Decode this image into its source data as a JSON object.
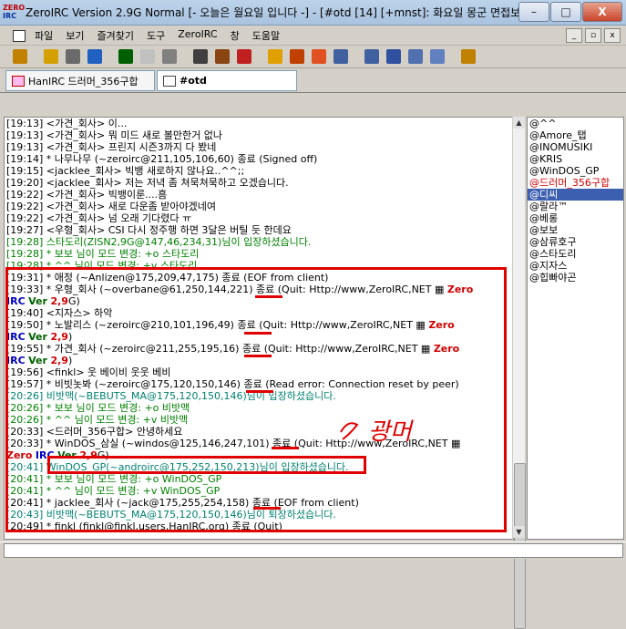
{
  "window": {
    "title": "ZeroIRC Version 2.9G Normal [- 오늘은 월요일 입니다 -] - [#otd [14] [+mnst]: 화요일 몽군 면접보러",
    "logo_line1": "ZERO",
    "logo_line2": "IRC",
    "minimize": "–",
    "maximize": "□",
    "close": "X"
  },
  "menu": {
    "items": [
      "파일",
      "보기",
      "즐겨찾기",
      "도구",
      "ZeroIRC",
      "창",
      "도움말"
    ],
    "mdi": [
      "_",
      "▫",
      "x"
    ]
  },
  "toolbar": {
    "buttons": [
      {
        "name": "connect-icon",
        "color": "#c08000"
      },
      {
        "name": "disconnect-icon",
        "color": "#d4a000"
      },
      {
        "name": "options-icon",
        "color": "#6a6a6a"
      },
      {
        "name": "favorites-icon",
        "color": "#2060c0"
      },
      {
        "name": "channel-list-icon",
        "color": "#006000"
      },
      {
        "name": "stop-icon",
        "color": "#c0c0c0"
      },
      {
        "name": "notify-icon",
        "color": "#808080"
      },
      {
        "name": "timer-icon",
        "color": "#404040"
      },
      {
        "name": "address-book-icon",
        "color": "#8b4513"
      },
      {
        "name": "color-icon",
        "color": "#c02020"
      },
      {
        "name": "script-icon",
        "color": "#e0a000"
      },
      {
        "name": "dcc-icon",
        "color": "#c04000"
      },
      {
        "name": "dcc-chat-icon",
        "color": "#e05020"
      },
      {
        "name": "cascade-icon",
        "color": "#4060a0"
      },
      {
        "name": "tile-icon",
        "color": "#4060a0"
      },
      {
        "name": "url-icon",
        "color": "#3050a0"
      },
      {
        "name": "log-icon",
        "color": "#5070b0"
      },
      {
        "name": "layout-icon",
        "color": "#6080c0"
      },
      {
        "name": "help-icon",
        "color": "#c08000"
      }
    ]
  },
  "tabs": [
    {
      "label": "HanIRC 드러머_356구합"
    },
    {
      "label": "#otd"
    }
  ],
  "chat": [
    {
      "time": "[19:13]",
      "text": " <가견_회사> 이...",
      "style": ""
    },
    {
      "time": "[19:13]",
      "text": " <가견_회사> 뭐 미드 새로 볼만한거 없나",
      "style": ""
    },
    {
      "time": "[19:13]",
      "text": " <가견_회사> 프린지 시즌3까지 다 봤네",
      "style": ""
    },
    {
      "time": "[19:14]",
      "text": " * 나무나무 (~zeroirc@211,105,106,60) 종료 (Signed off)",
      "style": ""
    },
    {
      "time": "[19:15]",
      "text": " <jacklee_회사> 빅뱅 새로하지 않나요..^^;;",
      "style": ""
    },
    {
      "time": "[19:20]",
      "text": " <jacklee_회사> 저는 저녁 좀 쳐묵쳐묵하고 오겠습니다.",
      "style": ""
    },
    {
      "time": "[19:22]",
      "text": " <가견_회사> 빅뱅이룬....흠",
      "style": ""
    },
    {
      "time": "[19:22]",
      "text": " <가견_회사> 새로 다운좀 받아야겠네여",
      "style": ""
    },
    {
      "time": "[19:22]",
      "text": " <가견_회사> 넘 오래 기다렸다 ㅠ",
      "style": ""
    },
    {
      "time": "[19:27]",
      "text": " <우형_회사> CSI 다시 정주행 하면 3달은 버틸 듯 한데요",
      "style": ""
    },
    {
      "time": "[19:28]",
      "text": " 스타도리(ZISN2,9G@147,46,234,31)님이 입장하셨습니다.",
      "style": "green"
    },
    {
      "time": "[19:28]",
      "text": " * 보보 님이 모드 변경: +o 스타도리",
      "style": "green"
    },
    {
      "time": "[19:28]",
      "text": " * ^^ 님이 모드 변경: +v 스타도리",
      "style": "green"
    },
    {
      "time": "[19:31]",
      "text": " * 애정 (~Anlizen@175,209,47,175) 종료 (EOF from client)",
      "style": ""
    },
    {
      "time": "[19:33]",
      "text": " * 우형_회사 (~overbane@61,250,144,221) 종료 (Quit: Http://www,ZeroIRC,NET ▦ ",
      "style": "",
      "tag": "Zero"
    },
    {
      "time": "",
      "text": "",
      "style": "",
      "tag_cont": [
        "IRC",
        "Ver",
        "2,9",
        "G)"
      ]
    },
    {
      "time": "[19:40]",
      "text": " <지자스> 하악",
      "style": ""
    },
    {
      "time": "[19:50]",
      "text": " * 노발리스 (~zeroirc@210,101,196,49) 종료 (Quit: Http://www,ZeroIRC,NET ▦ ",
      "style": "",
      "tag": "Zero"
    },
    {
      "time": "",
      "text": "",
      "style": "",
      "tag_cont": [
        "IRC",
        "Ver",
        "2,9",
        ")"
      ]
    },
    {
      "time": "[19:55]",
      "text": " * 가견_회사 (~zeroirc@211,255,195,16) 종료 (Quit: Http://www,ZeroIRC,NET ▦ ",
      "style": "",
      "tag": "Zero"
    },
    {
      "time": "",
      "text": "",
      "style": "",
      "tag_cont": [
        "IRC",
        "Ver",
        "2,9",
        ")"
      ]
    },
    {
      "time": "[19:56]",
      "text": " <finkl> 웃 베이비 웃웃 베비",
      "style": ""
    },
    {
      "time": "[19:57]",
      "text": " * 비빗놋봐 (~zeroirc@175,120,150,146) 종료 (Read error: Connection reset by peer)",
      "style": ""
    },
    {
      "time": "[20:26]",
      "text": " 비밧맥(~BEBUTS_MA@175,120,150,146)님이 입장하셨습니다.",
      "style": "join"
    },
    {
      "time": "[20:26]",
      "text": " * 보보 님이 모드 변경: +o 비밧맥",
      "style": "green"
    },
    {
      "time": "[20:26]",
      "text": " * ^^ 님이 모드 변경: +v 비밧맥",
      "style": "green"
    },
    {
      "time": "[20:33]",
      "text": " <드러머_356구합> 안녕하세요",
      "style": "",
      "nickred": true
    },
    {
      "time": "[20:33]",
      "text": " * WinDOS_삼실 (~windos@125,146,247,101) 종료 (Quit: Http://www,ZeroIRC,NET ▦",
      "style": ""
    },
    {
      "time": "",
      "text": "",
      "style": "",
      "tag_cont2": [
        "Zero",
        "IRC",
        "Ver",
        "2,9",
        "G)"
      ]
    },
    {
      "time": "[20:41]",
      "text": " WinDOS_GP(~androirc@175,252,150,213)님이 입장하셨습니다.",
      "style": "join"
    },
    {
      "time": "[20:41]",
      "text": " * 보보 님이 모드 변경: +o WinDOS_GP",
      "style": "green"
    },
    {
      "time": "[20:41]",
      "text": " * ^^ 님이 모드 변경: +v WinDOS_GP",
      "style": "green"
    },
    {
      "time": "[20:41]",
      "text": " * jacklee_회사 (~jack@175,255,254,158) 종료 (EOF from client)",
      "style": ""
    },
    {
      "time": "[20:43]",
      "text": " 비밧맥(~BEBUTS_MA@175,120,150,146)님이 퇴장하셨습니다.",
      "style": "join"
    },
    {
      "time": "[20:49]",
      "text": " * finkl (finkl@finkl,users,HanIRC,org) 종료 (Quit)",
      "style": ""
    }
  ],
  "nicklist": [
    {
      "nick": "@^^",
      "style": ""
    },
    {
      "nick": "@Amore_탭",
      "style": ""
    },
    {
      "nick": "@INOMUSIKI",
      "style": ""
    },
    {
      "nick": "@KRIS",
      "style": ""
    },
    {
      "nick": "@WinDOS_GP",
      "style": ""
    },
    {
      "nick": "@드러머_356구합",
      "style": "red"
    },
    {
      "nick": "@디씨",
      "style": "sel"
    },
    {
      "nick": "@랄라™",
      "style": ""
    },
    {
      "nick": "@베롱",
      "style": ""
    },
    {
      "nick": "@보보",
      "style": ""
    },
    {
      "nick": "@삼류호구",
      "style": ""
    },
    {
      "nick": "@스타도리",
      "style": ""
    },
    {
      "nick": "@지자스",
      "style": ""
    },
    {
      "nick": "@힙빠야곤",
      "style": ""
    }
  ],
  "annotation": {
    "handwritten": "광머",
    "color": "#e00000"
  },
  "colors": {
    "accent_red": "#e00000",
    "join_teal": "#008070",
    "mode_green": "#008000"
  }
}
